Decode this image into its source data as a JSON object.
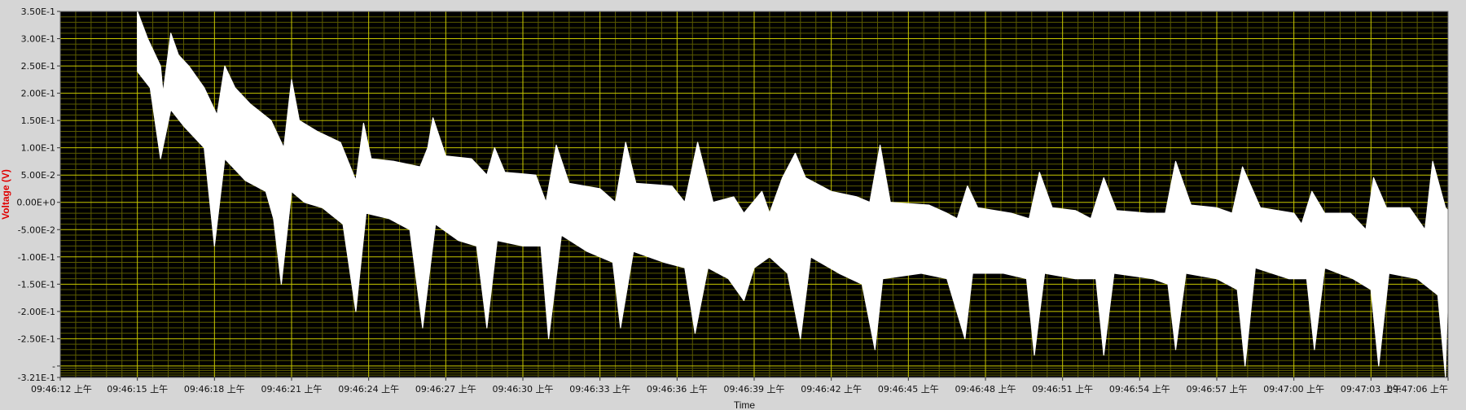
{
  "colors": {
    "panel_bg": "#d6d6d6",
    "plot_bg": "#000000",
    "grid_major": "#c8c800",
    "grid_minor": "#5a5a00",
    "trace": "#ffffff",
    "ylabel_color": "#e00000",
    "tick_text": "#111111"
  },
  "chart_data": {
    "type": "line",
    "title": "",
    "xlabel": "Time",
    "ylabel": "Voltage (V)",
    "ylim": [
      -0.321,
      0.35
    ],
    "xlim": [
      "09:46:12",
      "09:47:06"
    ],
    "grid": true,
    "y_ticks": [
      {
        "value": 0.35,
        "label": "3.50E-1"
      },
      {
        "value": 0.3,
        "label": "3.00E-1"
      },
      {
        "value": 0.25,
        "label": "2.50E-1"
      },
      {
        "value": 0.2,
        "label": "2.00E-1"
      },
      {
        "value": 0.15,
        "label": "1.50E-1"
      },
      {
        "value": 0.1,
        "label": "1.00E-1"
      },
      {
        "value": 0.05,
        "label": "5.00E-2"
      },
      {
        "value": 0.0,
        "label": "0.00E+0"
      },
      {
        "value": -0.05,
        "label": "-5.00E-2"
      },
      {
        "value": -0.1,
        "label": "-1.00E-1"
      },
      {
        "value": -0.15,
        "label": "-1.50E-1"
      },
      {
        "value": -0.2,
        "label": "-2.00E-1"
      },
      {
        "value": -0.25,
        "label": "-2.50E-1"
      },
      {
        "value": -0.3,
        "label": "-"
      },
      {
        "value": -0.321,
        "label": "-3.21E-1"
      }
    ],
    "x_ticks": [
      {
        "value": "09:46:12",
        "label": "09:46:12 上午"
      },
      {
        "value": "09:46:15",
        "label": "09:46:15 上午"
      },
      {
        "value": "09:46:18",
        "label": "09:46:18 上午"
      },
      {
        "value": "09:46:21",
        "label": "09:46:21 上午"
      },
      {
        "value": "09:46:24",
        "label": "09:46:24 上午"
      },
      {
        "value": "09:46:27",
        "label": "09:46:27 上午"
      },
      {
        "value": "09:46:30",
        "label": "09:46:30 上午"
      },
      {
        "value": "09:46:33",
        "label": "09:46:33 上午"
      },
      {
        "value": "09:46:36",
        "label": "09:46:36 上午"
      },
      {
        "value": "09:46:39",
        "label": "09:46:39 上午"
      },
      {
        "value": "09:46:42",
        "label": "09:46:42 上午"
      },
      {
        "value": "09:46:45",
        "label": "09:46:45 上午"
      },
      {
        "value": "09:46:48",
        "label": "09:46:48 上午"
      },
      {
        "value": "09:46:51",
        "label": "09:46:51 上午"
      },
      {
        "value": "09:46:54",
        "label": "09:46:54 上午"
      },
      {
        "value": "09:46:57",
        "label": "09:46:57 上午"
      },
      {
        "value": "09:47:00",
        "label": "09:47:00 上午"
      },
      {
        "value": "09:47:03",
        "label": "09:47:03 上午"
      },
      {
        "value": "09:47:06",
        "label": "09:47:06 上午"
      }
    ],
    "series": [
      {
        "upper": [
          [
            "09:46:15.0",
            0.35
          ],
          [
            "09:46:15.4",
            0.3
          ],
          [
            "09:46:15.9",
            0.25
          ],
          [
            "09:46:16.0",
            0.2
          ],
          [
            "09:46:16.3",
            0.31
          ],
          [
            "09:46:16.6",
            0.27
          ],
          [
            "09:46:17.0",
            0.25
          ],
          [
            "09:46:17.6",
            0.21
          ],
          [
            "09:46:18.1",
            0.16
          ],
          [
            "09:46:18.4",
            0.25
          ],
          [
            "09:46:18.8",
            0.21
          ],
          [
            "09:46:19.4",
            0.18
          ],
          [
            "09:46:20.2",
            0.15
          ],
          [
            "09:46:20.7",
            0.1
          ],
          [
            "09:46:21.0",
            0.225
          ],
          [
            "09:46:21.3",
            0.15
          ],
          [
            "09:46:22.0",
            0.13
          ],
          [
            "09:46:22.9",
            0.11
          ],
          [
            "09:46:23.5",
            0.04
          ],
          [
            "09:46:23.8",
            0.145
          ],
          [
            "09:46:24.1",
            0.08
          ],
          [
            "09:46:25.0",
            0.075
          ],
          [
            "09:46:26.0",
            0.065
          ],
          [
            "09:46:26.3",
            0.1
          ],
          [
            "09:46:26.5",
            0.155
          ],
          [
            "09:46:27.0",
            0.085
          ],
          [
            "09:46:28.0",
            0.08
          ],
          [
            "09:46:28.6",
            0.05
          ],
          [
            "09:46:28.9",
            0.1
          ],
          [
            "09:46:29.3",
            0.055
          ],
          [
            "09:46:30.5",
            0.05
          ],
          [
            "09:46:30.9",
            0.0
          ],
          [
            "09:46:31.3",
            0.105
          ],
          [
            "09:46:31.8",
            0.035
          ],
          [
            "09:46:33.0",
            0.025
          ],
          [
            "09:46:33.6",
            0.0
          ],
          [
            "09:46:34.0",
            0.11
          ],
          [
            "09:46:34.4",
            0.035
          ],
          [
            "09:46:35.8",
            0.03
          ],
          [
            "09:46:36.3",
            0.0
          ],
          [
            "09:46:36.8",
            0.11
          ],
          [
            "09:46:37.4",
            0.0
          ],
          [
            "09:46:38.2",
            0.01
          ],
          [
            "09:46:38.6",
            -0.02
          ],
          [
            "09:46:39.3",
            0.02
          ],
          [
            "09:46:39.6",
            -0.02
          ],
          [
            "09:46:40.1",
            0.045
          ],
          [
            "09:46:40.6",
            0.09
          ],
          [
            "09:46:41.0",
            0.045
          ],
          [
            "09:46:42.0",
            0.02
          ],
          [
            "09:46:43.0",
            0.01
          ],
          [
            "09:46:43.5",
            0.0
          ],
          [
            "09:46:43.9",
            0.105
          ],
          [
            "09:46:44.3",
            0.0
          ],
          [
            "09:46:45.8",
            -0.005
          ],
          [
            "09:46:46.5",
            -0.02
          ],
          [
            "09:46:46.9",
            -0.03
          ],
          [
            "09:46:47.3",
            0.03
          ],
          [
            "09:46:47.7",
            -0.01
          ],
          [
            "09:46:49.0",
            -0.02
          ],
          [
            "09:46:49.7",
            -0.03
          ],
          [
            "09:46:50.1",
            0.055
          ],
          [
            "09:46:50.6",
            -0.01
          ],
          [
            "09:46:51.5",
            -0.015
          ],
          [
            "09:46:52.1",
            -0.03
          ],
          [
            "09:46:52.6",
            0.045
          ],
          [
            "09:46:53.1",
            -0.015
          ],
          [
            "09:46:54.3",
            -0.02
          ],
          [
            "09:46:55.0",
            -0.02
          ],
          [
            "09:46:55.4",
            0.075
          ],
          [
            "09:46:56.0",
            -0.005
          ],
          [
            "09:46:57.0",
            -0.01
          ],
          [
            "09:46:57.6",
            -0.02
          ],
          [
            "09:46:58.0",
            0.065
          ],
          [
            "09:46:58.7",
            -0.01
          ],
          [
            "09:47:00.0",
            -0.02
          ],
          [
            "09:47:00.3",
            -0.04
          ],
          [
            "09:47:00.7",
            0.02
          ],
          [
            "09:47:01.2",
            -0.02
          ],
          [
            "09:47:02.2",
            -0.02
          ],
          [
            "09:47:02.8",
            -0.05
          ],
          [
            "09:47:03.1",
            0.045
          ],
          [
            "09:47:03.6",
            -0.01
          ],
          [
            "09:47:04.5",
            -0.01
          ],
          [
            "09:47:05.1",
            -0.05
          ],
          [
            "09:47:05.4",
            0.075
          ],
          [
            "09:47:05.9",
            -0.01
          ],
          [
            "09:47:06.0",
            -0.015
          ]
        ],
        "lower": [
          [
            "09:46:15.0",
            0.24
          ],
          [
            "09:46:15.5",
            0.21
          ],
          [
            "09:46:15.9",
            0.08
          ],
          [
            "09:46:16.3",
            0.17
          ],
          [
            "09:46:16.8",
            0.14
          ],
          [
            "09:46:17.6",
            0.1
          ],
          [
            "09:46:18.0",
            -0.08
          ],
          [
            "09:46:18.4",
            0.08
          ],
          [
            "09:46:19.2",
            0.04
          ],
          [
            "09:46:20.0",
            0.02
          ],
          [
            "09:46:20.3",
            -0.03
          ],
          [
            "09:46:20.6",
            -0.15
          ],
          [
            "09:46:21.0",
            0.02
          ],
          [
            "09:46:21.5",
            0.0
          ],
          [
            "09:46:22.2",
            -0.01
          ],
          [
            "09:46:23.0",
            -0.04
          ],
          [
            "09:46:23.5",
            -0.2
          ],
          [
            "09:46:23.9",
            -0.02
          ],
          [
            "09:46:24.8",
            -0.03
          ],
          [
            "09:46:25.6",
            -0.05
          ],
          [
            "09:46:26.1",
            -0.23
          ],
          [
            "09:46:26.6",
            -0.04
          ],
          [
            "09:46:27.5",
            -0.07
          ],
          [
            "09:46:28.2",
            -0.08
          ],
          [
            "09:46:28.6",
            -0.23
          ],
          [
            "09:46:29.0",
            -0.07
          ],
          [
            "09:46:30.0",
            -0.08
          ],
          [
            "09:46:30.7",
            -0.08
          ],
          [
            "09:46:31.0",
            -0.25
          ],
          [
            "09:46:31.5",
            -0.06
          ],
          [
            "09:46:32.5",
            -0.09
          ],
          [
            "09:46:33.5",
            -0.11
          ],
          [
            "09:46:33.8",
            -0.23
          ],
          [
            "09:46:34.3",
            -0.09
          ],
          [
            "09:46:35.5",
            -0.11
          ],
          [
            "09:46:36.3",
            -0.12
          ],
          [
            "09:46:36.7",
            -0.24
          ],
          [
            "09:46:37.2",
            -0.12
          ],
          [
            "09:46:38.0",
            -0.14
          ],
          [
            "09:46:38.6",
            -0.18
          ],
          [
            "09:46:39.0",
            -0.12
          ],
          [
            "09:46:39.6",
            -0.1
          ],
          [
            "09:46:40.3",
            -0.13
          ],
          [
            "09:46:40.8",
            -0.25
          ],
          [
            "09:46:41.2",
            -0.1
          ],
          [
            "09:46:42.3",
            -0.13
          ],
          [
            "09:46:43.2",
            -0.15
          ],
          [
            "09:46:43.7",
            -0.27
          ],
          [
            "09:46:44.0",
            -0.14
          ],
          [
            "09:46:45.5",
            -0.13
          ],
          [
            "09:46:46.5",
            -0.14
          ],
          [
            "09:46:47.2",
            -0.25
          ],
          [
            "09:46:47.5",
            -0.13
          ],
          [
            "09:46:48.7",
            -0.13
          ],
          [
            "09:46:49.6",
            -0.14
          ],
          [
            "09:46:49.9",
            -0.28
          ],
          [
            "09:46:50.3",
            -0.13
          ],
          [
            "09:46:51.5",
            -0.14
          ],
          [
            "09:46:52.3",
            -0.14
          ],
          [
            "09:46:52.6",
            -0.28
          ],
          [
            "09:46:53.0",
            -0.13
          ],
          [
            "09:46:54.5",
            -0.14
          ],
          [
            "09:46:55.1",
            -0.15
          ],
          [
            "09:46:55.4",
            -0.27
          ],
          [
            "09:46:55.8",
            -0.13
          ],
          [
            "09:46:57.0",
            -0.14
          ],
          [
            "09:46:57.8",
            -0.16
          ],
          [
            "09:46:58.1",
            -0.3
          ],
          [
            "09:46:58.5",
            -0.12
          ],
          [
            "09:46:59.8",
            -0.14
          ],
          [
            "09:47:00.5",
            -0.14
          ],
          [
            "09:47:00.8",
            -0.27
          ],
          [
            "09:47:01.2",
            -0.12
          ],
          [
            "09:47:02.3",
            -0.14
          ],
          [
            "09:47:03.0",
            -0.16
          ],
          [
            "09:47:03.3",
            -0.3
          ],
          [
            "09:47:03.7",
            -0.13
          ],
          [
            "09:47:04.8",
            -0.14
          ],
          [
            "09:47:05.6",
            -0.17
          ],
          [
            "09:47:05.9",
            -0.32
          ],
          [
            "09:47:06.0",
            -0.14
          ]
        ]
      }
    ]
  }
}
